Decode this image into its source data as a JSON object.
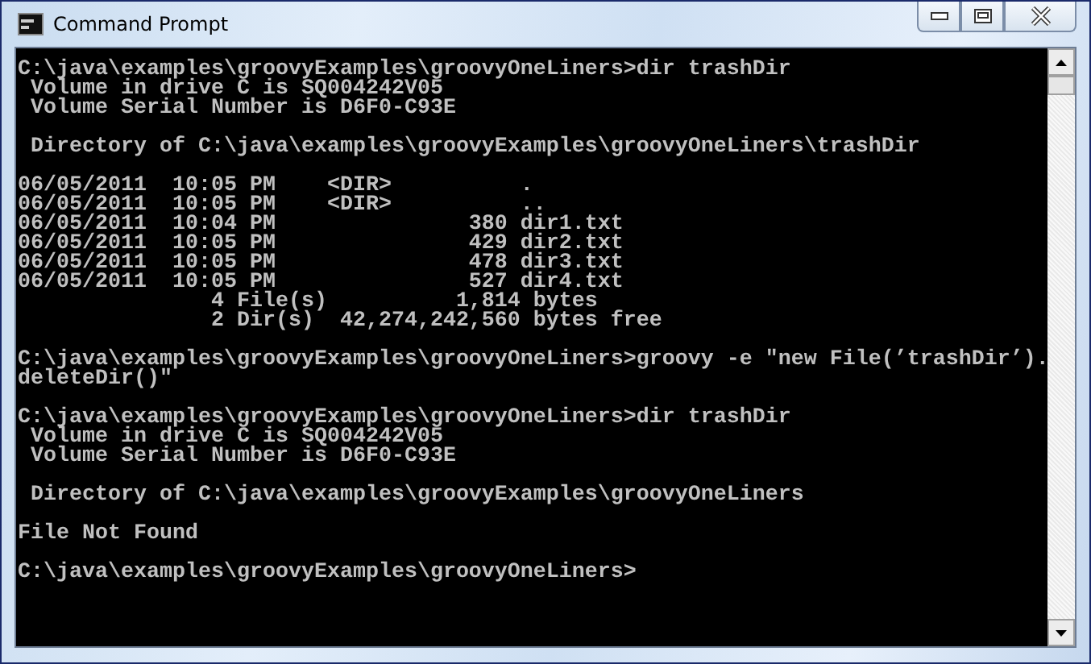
{
  "window": {
    "title": "Command Prompt"
  },
  "console": {
    "blocks": [
      {
        "lines": [
          "C:\\java\\examples\\groovyExamples\\groovyOneLiners>dir trashDir",
          " Volume in drive C is SQ004242V05",
          " Volume Serial Number is D6F0-C93E"
        ]
      },
      {
        "lines": [
          " Directory of C:\\java\\examples\\groovyExamples\\groovyOneLiners\\trashDir"
        ]
      },
      {
        "lines": [
          "06/05/2011  10:05 PM    <DIR>          .",
          "06/05/2011  10:05 PM    <DIR>          ..",
          "06/05/2011  10:04 PM               380 dir1.txt",
          "06/05/2011  10:05 PM               429 dir2.txt",
          "06/05/2011  10:05 PM               478 dir3.txt",
          "06/05/2011  10:05 PM               527 dir4.txt",
          "               4 File(s)          1,814 bytes",
          "               2 Dir(s)  42,274,242,560 bytes free"
        ]
      },
      {
        "lines": [
          "C:\\java\\examples\\groovyExamples\\groovyOneLiners>groovy -e \"new File(’trashDir’).",
          "deleteDir()\""
        ]
      },
      {
        "lines": [
          "C:\\java\\examples\\groovyExamples\\groovyOneLiners>dir trashDir",
          " Volume in drive C is SQ004242V05",
          " Volume Serial Number is D6F0-C93E"
        ]
      },
      {
        "lines": [
          " Directory of C:\\java\\examples\\groovyExamples\\groovyOneLiners"
        ]
      },
      {
        "lines": [
          "File Not Found"
        ]
      },
      {
        "lines": [
          "C:\\java\\examples\\groovyExamples\\groovyOneLiners>"
        ]
      }
    ]
  }
}
